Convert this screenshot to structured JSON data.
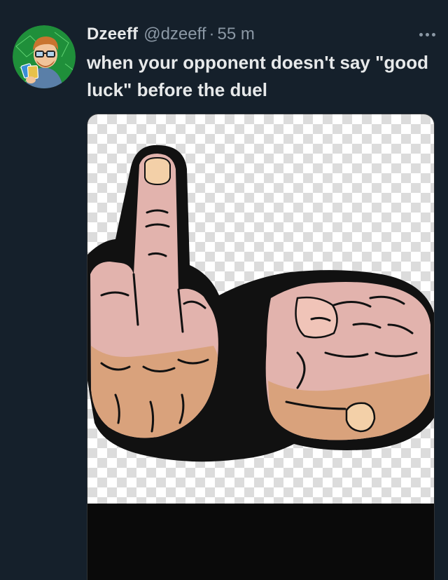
{
  "tweet": {
    "display_name": "Dzeeff",
    "handle": "@dzeeff",
    "separator": "·",
    "time": "55 m",
    "text": "when your opponent doesn't say \"good luck\" before the duel",
    "more_icon": "more-horizontal-icon",
    "avatar_icon": "cartoon-avatar"
  },
  "media": {
    "image_content": "embroidered-patch-middle-finger-and-fist",
    "background": "transparency-checkerboard"
  },
  "colors": {
    "background": "#15202b",
    "primary_text": "#e7e9ea",
    "secondary_text": "#8b98a5",
    "skin": "#d9a27c",
    "skin_pink": "#e2b3ad",
    "outline": "#111111"
  }
}
